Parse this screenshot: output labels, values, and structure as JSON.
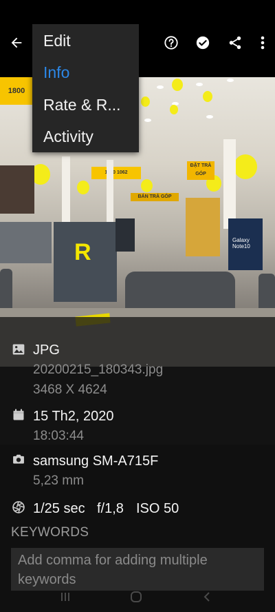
{
  "menu": {
    "items": [
      {
        "label": "Edit"
      },
      {
        "label": "Info"
      },
      {
        "label": "Rate & R..."
      },
      {
        "label": "Activity"
      }
    ]
  },
  "photo": {
    "signs": [
      "1800",
      "1800 1062",
      "ĐẶT TRẢ GÓP",
      "BÁN TRẢ GÓP",
      "Galaxy Note10"
    ],
    "brand_letter": "R"
  },
  "info": {
    "file_type": "JPG",
    "file_name": "20200215_180343.jpg",
    "dimensions": "3468 X 4624",
    "date": "15 Th2, 2020",
    "time": "18:03:44",
    "camera": "samsung SM-A715F",
    "focal_length": "5,23 mm",
    "shutter": "1/25 sec",
    "aperture": "f/1,8",
    "iso": "ISO 50",
    "keywords_label": "KEYWORDS",
    "keywords_placeholder": "Add comma for adding multiple keywords"
  },
  "colors": {
    "accent": "#2c87e6",
    "menu_bg": "#262626"
  }
}
